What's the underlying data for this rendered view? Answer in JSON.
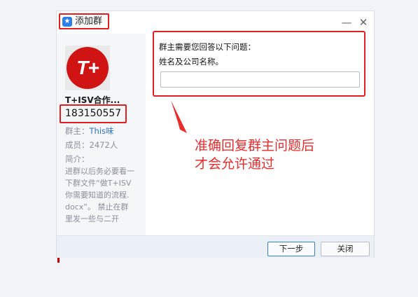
{
  "window": {
    "title": "添加群",
    "app_icon": "qq-star-icon",
    "minimize_label": "—",
    "close_label": "✕"
  },
  "group": {
    "avatar_text": "T+",
    "name": "T+ISV合作...",
    "id": "183150557",
    "owner_label": "群主：",
    "owner_value": "This味",
    "members_label": "成员：",
    "members_value": "2472人",
    "intro_label": "简介：",
    "intro": "进群以后务必要看一\n下群文件“做T+ISV\n你需要知道的流程.\ndocx”。 禁止在群\n里发一些与二开"
  },
  "question": {
    "title": "群主需要您回答以下问题：",
    "text": "姓名及公司名称。",
    "answer_value": "",
    "answer_placeholder": ""
  },
  "annotation": {
    "text": "准确回复群主问题后\n才会允许通过",
    "color": "#ee2b2b"
  },
  "footer": {
    "next_label": "下一步",
    "close_label": "关闭"
  },
  "colors": {
    "highlight_border": "#e02020",
    "accent": "#3b7fd6",
    "link": "#2e74c9",
    "brand_red": "#d01414"
  }
}
